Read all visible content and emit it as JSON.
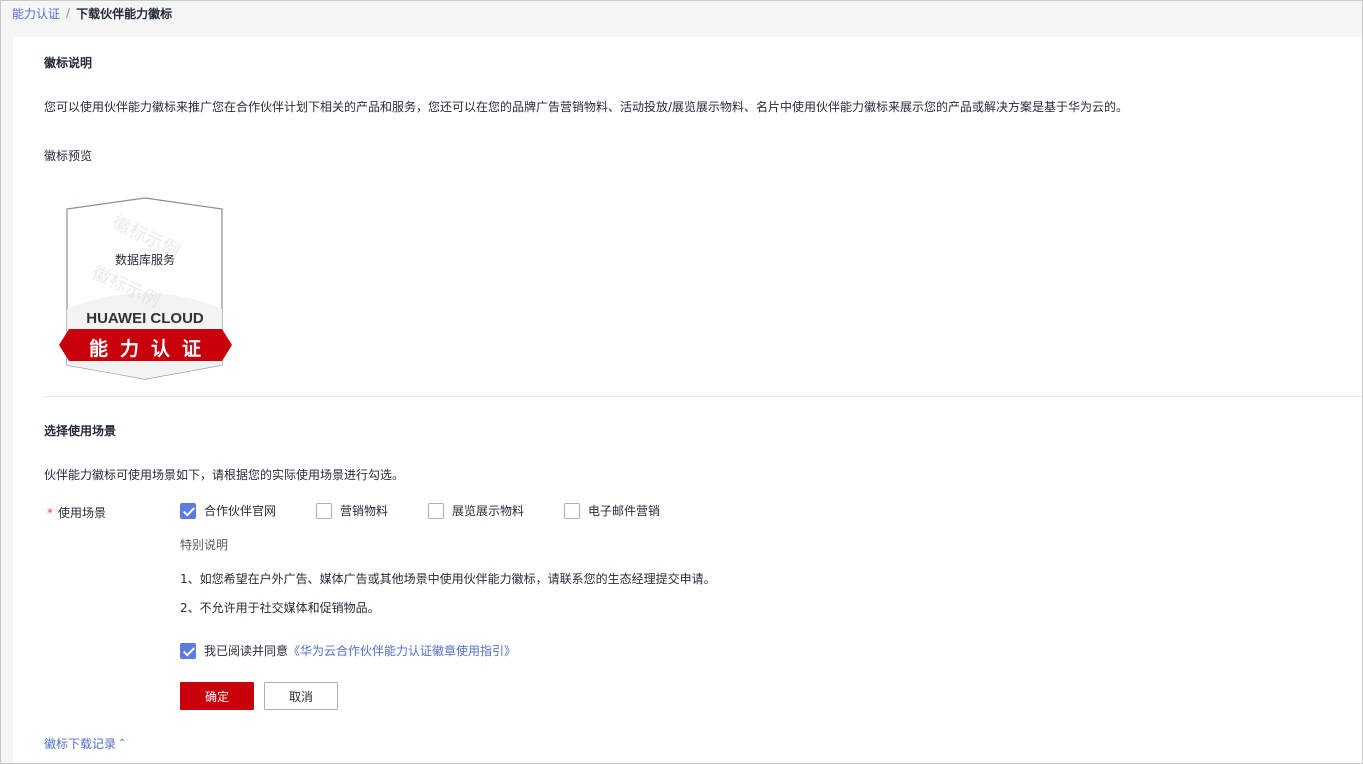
{
  "breadcrumb": {
    "parent": "能力认证",
    "separator": "/",
    "current": "下载伙伴能力徽标"
  },
  "badge_section": {
    "title": "徽标说明",
    "description": "您可以使用伙伴能力徽标来推广您在合作伙伴计划下相关的产品和服务，您还可以在您的品牌广告营销物料、活动投放/展览展示物料、名片中使用伙伴能力徽标来展示您的产品或解决方案是基于华为云的。",
    "preview_label": "徽标预览",
    "badge": {
      "service_name": "数据库服务",
      "brand": "HUAWEI CLOUD",
      "ribbon_text": "能力认证",
      "watermark": "徽标示例",
      "accent_color": "#c7000b"
    }
  },
  "scenario_section": {
    "title": "选择使用场景",
    "description": "伙伴能力徽标可使用场景如下，请根据您的实际使用场景进行勾选。",
    "field_label": "使用场景",
    "required_mark": "*",
    "options": [
      {
        "label": "合作伙伴官网",
        "checked": true
      },
      {
        "label": "营销物料",
        "checked": false
      },
      {
        "label": "展览展示物料",
        "checked": false
      },
      {
        "label": "电子邮件营销",
        "checked": false
      }
    ],
    "notes_title": "特别说明",
    "notes": [
      "1、如您希望在户外广告、媒体广告或其他场景中使用伙伴能力徽标，请联系您的生态经理提交申请。",
      "2、不允许用于社交媒体和促销物品。"
    ],
    "agreement": {
      "checked": true,
      "prefix": "我已阅读并同意",
      "link": "《华为云合作伙伴能力认证徽章使用指引》"
    },
    "confirm_label": "确定",
    "cancel_label": "取消"
  },
  "download_record_label": "徽标下载记录",
  "download_record_icon": "chevron-up-icon"
}
